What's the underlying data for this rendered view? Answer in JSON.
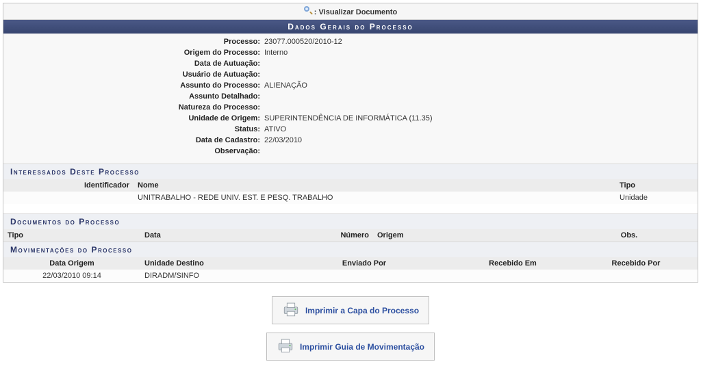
{
  "title": "Visualizar Documento",
  "section_main": "Dados Gerais do Processo",
  "fields": {
    "processo": {
      "label": "Processo:",
      "value": "23077.000520/2010-12"
    },
    "origem_processo": {
      "label": "Origem do Processo:",
      "value": "Interno"
    },
    "data_autuacao": {
      "label": "Data de Autuação:",
      "value": ""
    },
    "usuario_autuacao": {
      "label": "Usuário de Autuação:",
      "value": ""
    },
    "assunto_processo": {
      "label": "Assunto do Processo:",
      "value": "ALIENAÇÃO"
    },
    "assunto_detalhado": {
      "label": "Assunto Detalhado:",
      "value": ""
    },
    "natureza_processo": {
      "label": "Natureza do Processo:",
      "value": ""
    },
    "unidade_origem": {
      "label": "Unidade de Origem:",
      "value": "SUPERINTENDÊNCIA DE INFORMÁTICA (11.35)"
    },
    "status": {
      "label": "Status:",
      "value": "ATIVO"
    },
    "data_cadastro": {
      "label": "Data de Cadastro:",
      "value": "22/03/2010"
    },
    "observacao": {
      "label": "Observação:",
      "value": ""
    }
  },
  "interessados": {
    "title": "Interessados Deste Processo",
    "headers": {
      "identificador": "Identificador",
      "nome": "Nome",
      "tipo": "Tipo"
    },
    "rows": [
      {
        "identificador": "",
        "nome": "UNITRABALHO - REDE UNIV. EST. E PESQ. TRABALHO",
        "tipo": "Unidade"
      }
    ]
  },
  "documentos": {
    "title": "Documentos do Processo",
    "headers": {
      "tipo": "Tipo",
      "data": "Data",
      "numero": "Número",
      "origem": "Origem",
      "obs": "Obs."
    }
  },
  "movimentacoes": {
    "title": "Movimentações do Processo",
    "headers": {
      "data_origem": "Data Origem",
      "unidade_destino": "Unidade Destino",
      "enviado_por": "Enviado Por",
      "recebido_em": "Recebido Em",
      "recebido_por": "Recebido Por"
    },
    "rows": [
      {
        "data_origem": "22/03/2010 09:14",
        "unidade_destino": "DIRADM/SINFO",
        "enviado_por": "",
        "recebido_em": "",
        "recebido_por": ""
      }
    ]
  },
  "actions": {
    "imprimir_capa": "Imprimir a Capa do Processo",
    "imprimir_guia": "Imprimir Guia de Movimentação"
  }
}
